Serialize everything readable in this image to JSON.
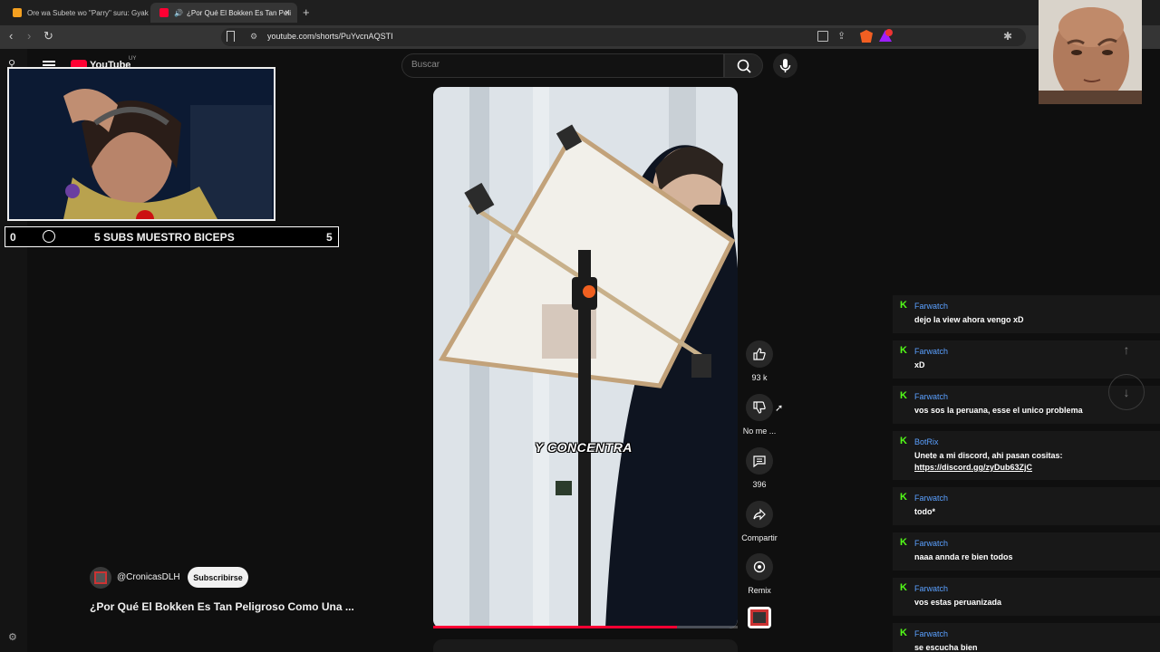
{
  "browser": {
    "tabs": [
      {
        "label": "Ore wa Subete wo \"Parry\" suru: Gyak",
        "active": false,
        "favicon_color": "#f4a020"
      },
      {
        "label": "¿Por Qué El Bokken Es Tan Peli",
        "active": true,
        "favicon_color": "#ff0033"
      }
    ],
    "new_tab": "+",
    "close_glyph": "×",
    "url": "youtube.com/shorts/PuYvcnAQSTI"
  },
  "youtube": {
    "logo_text": "YouTube",
    "logo_sup": "UY",
    "search_placeholder": "Buscar",
    "caption": "Y CONCENTRA",
    "progress_fraction": 0.8,
    "actions": {
      "like_count": "93 k",
      "dislike_label": "No me ...",
      "comments_count": "396",
      "share_label": "Compartir",
      "remix_label": "Remix"
    },
    "channel": {
      "handle": "@CronicasDLH",
      "subscribe": "Subscribirse"
    },
    "video_title": "¿Por Qué El Bokken Es Tan Peligroso Como Una ..."
  },
  "overlay": {
    "subs_left": "0",
    "subs_title": "5 SUBS MUESTRO BICEPS",
    "subs_right": "5"
  },
  "chat": [
    {
      "user": "Farwatch",
      "message": "dejo la view ahora vengo xD"
    },
    {
      "user": "Farwatch",
      "message": "xD"
    },
    {
      "user": "Farwatch",
      "message": "vos sos la peruana, esse el unico problema"
    },
    {
      "user": "BotRix",
      "message": "Unete a mi discord, ahi pasan cositas:",
      "link": "https://discord.gg/zyDub63ZjC"
    },
    {
      "user": "Farwatch",
      "message": "todo*"
    },
    {
      "user": "Farwatch",
      "message": "naaa annda re bien todos"
    },
    {
      "user": "Farwatch",
      "message": "vos estas peruanizada"
    },
    {
      "user": "Farwatch",
      "message": "se escucha bien"
    }
  ],
  "colors": {
    "accent_red": "#ff0033",
    "kick_green": "#53fc18",
    "chat_user": "#5aa0ff"
  }
}
